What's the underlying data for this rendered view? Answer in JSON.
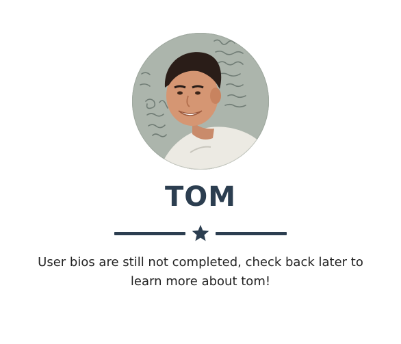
{
  "profile": {
    "name": "TOM",
    "bio": "User bios are still not completed, check back later to learn more about tom!",
    "photo_alt": "Tom",
    "divider_icon": "star-icon"
  },
  "colors": {
    "heading": "#2c3e50",
    "divider": "#2c3e50",
    "text": "#222222",
    "background": "#ffffff"
  }
}
